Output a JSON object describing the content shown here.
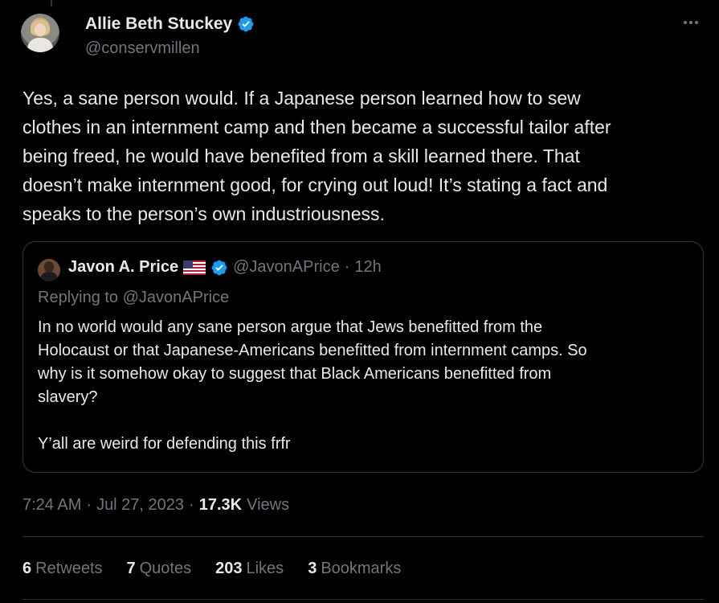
{
  "author": {
    "name": "Allie Beth Stuckey",
    "handle": "@conservmillen",
    "verified": true
  },
  "tweet": {
    "text": "Yes, a sane person would. If a Japanese person learned how to sew\nclothes in an internment camp and then became a successful tailor after\nbeing freed, he would have benefited from a skill learned there. That\ndoesn’t make internment good, for crying out loud! It’s stating a fact and\nspeaks to the person’s own industriousness.",
    "time": "7:24 AM",
    "date": "Jul 27, 2023",
    "views_count": "17.3K",
    "views_label": "Views",
    "separator": "·"
  },
  "quoted": {
    "name": "Javon A. Price",
    "flag": "🇺🇸",
    "handle": "@JavonAPrice",
    "separator": "·",
    "time": "12h",
    "replying_to": "Replying to @JavonAPrice",
    "text": "In no world would any sane person argue that Jews benefitted from the\nHolocaust or that Japanese-Americans benefitted from internment camps. So\nwhy is it somehow okay to suggest that Black Americans benefitted from\nslavery?\n\nY’all are weird for defending this frfr"
  },
  "stats": [
    {
      "count": "6",
      "label": "Retweets"
    },
    {
      "count": "7",
      "label": "Quotes"
    },
    {
      "count": "203",
      "label": "Likes"
    },
    {
      "count": "3",
      "label": "Bookmarks"
    }
  ],
  "icons": {
    "more": "more-horizontal-icon",
    "verified": "verified-badge-icon"
  },
  "colors": {
    "background": "#000000",
    "text": "#e7e9ea",
    "muted": "#71767b",
    "verified": "#1d9bf0",
    "border": "#333639"
  }
}
